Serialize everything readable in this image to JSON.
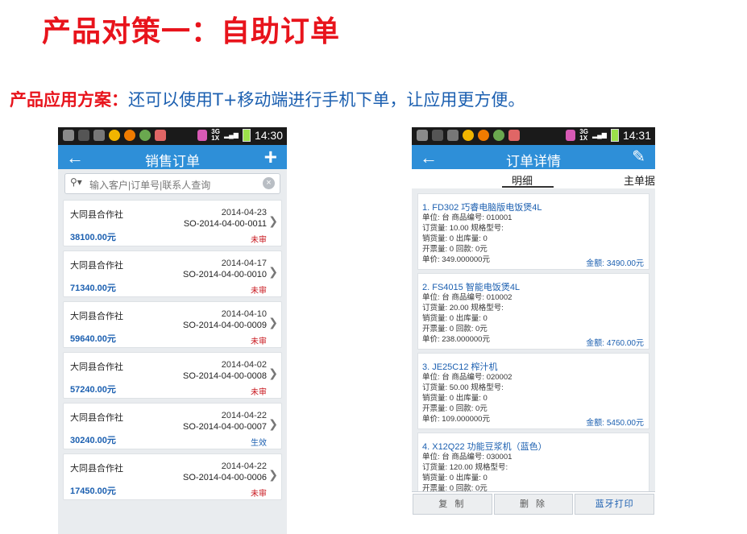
{
  "slide": {
    "title": "产品对策一：自助订单",
    "subtitle_label": "产品应用方案：",
    "subtitle_text": "还可以使用T+移动端进行手机下单，让应用更方便。"
  },
  "phone1": {
    "time": "14:30",
    "title": "销售订单",
    "search_placeholder": "输入客户|订单号|联系人查询",
    "orders": [
      {
        "customer": "大同县合作社",
        "date": "2014-04-23",
        "order_no": "SO-2014-04-00-0011",
        "amount": "38100.00元",
        "status": "未审",
        "status_color": "#c8161d"
      },
      {
        "customer": "大同县合作社",
        "date": "2014-04-17",
        "order_no": "SO-2014-04-00-0010",
        "amount": "71340.00元",
        "status": "未审",
        "status_color": "#c8161d"
      },
      {
        "customer": "大同县合作社",
        "date": "2014-04-10",
        "order_no": "SO-2014-04-00-0009",
        "amount": "59640.00元",
        "status": "未审",
        "status_color": "#c8161d"
      },
      {
        "customer": "大同县合作社",
        "date": "2014-04-02",
        "order_no": "SO-2014-04-00-0008",
        "amount": "57240.00元",
        "status": "未审",
        "status_color": "#c8161d"
      },
      {
        "customer": "大同县合作社",
        "date": "2014-04-22",
        "order_no": "SO-2014-04-00-0007",
        "amount": "30240.00元",
        "status": "生效",
        "status_color": "#1b5fb0"
      },
      {
        "customer": "大同县合作社",
        "date": "2014-04-22",
        "order_no": "SO-2014-04-00-0006",
        "amount": "17450.00元",
        "status": "未审",
        "status_color": "#c8161d"
      }
    ]
  },
  "phone2": {
    "time": "14:31",
    "title": "订单详情",
    "tab_detail": "明细",
    "tab_header": "主单据",
    "items": [
      {
        "title": "1. FD302 巧睿电脑版电饭煲4L",
        "unit_line": "单位: 台   商品编号: 010001",
        "order_line": "订货量: 10.00   规格型号:",
        "sales_line": "销货量: 0   出库量: 0",
        "invoice_line": "开票量: 0   回款: 0元",
        "price_line": "单价: 349.000000元",
        "total": "金额: 3490.00元"
      },
      {
        "title": "2. FS4015 智能电饭煲4L",
        "unit_line": "单位: 台   商品编号: 010002",
        "order_line": "订货量: 20.00   规格型号:",
        "sales_line": "销货量: 0   出库量: 0",
        "invoice_line": "开票量: 0   回款: 0元",
        "price_line": "单价: 238.000000元",
        "total": "金额: 4760.00元"
      },
      {
        "title": "3. JE25C12 榨汁机",
        "unit_line": "单位: 台   商品编号: 020002",
        "order_line": "订货量: 50.00   规格型号:",
        "sales_line": "销货量: 0   出库量: 0",
        "invoice_line": "开票量: 0   回款: 0元",
        "price_line": "单价: 109.000000元",
        "total": "金额: 5450.00元"
      },
      {
        "title": "4. X12Q22 功能豆浆机（蓝色）",
        "unit_line": "单位: 台   商品编号: 030001",
        "order_line": "订货量: 120.00   规格型号:",
        "sales_line": "销货量: 0   出库量: 0",
        "invoice_line": "开票量: 0   回款: 0元"
      }
    ],
    "buttons": {
      "copy": "复 制",
      "delete": "删 除",
      "print": "蓝牙打印"
    }
  }
}
